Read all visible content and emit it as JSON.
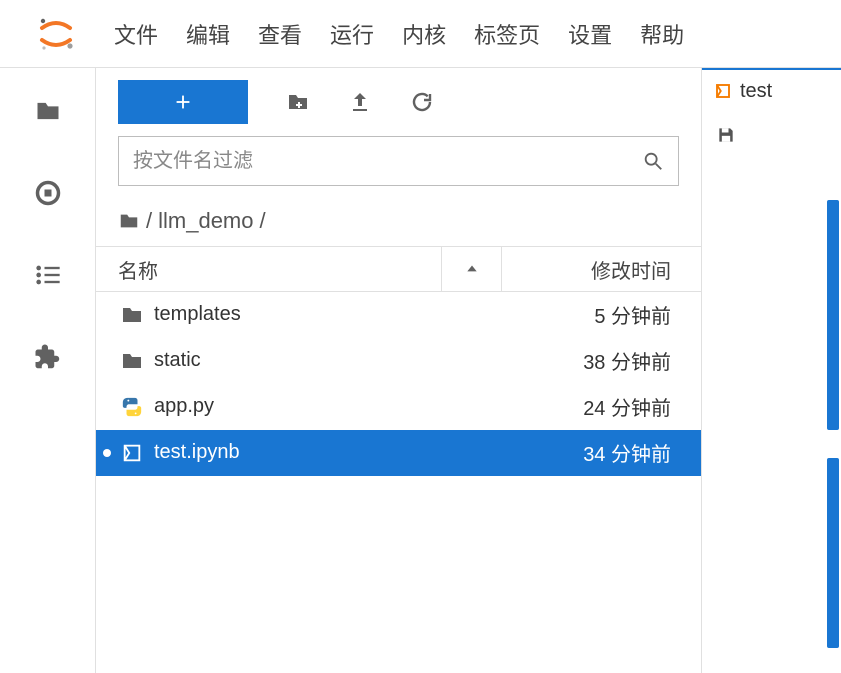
{
  "menubar": {
    "items": [
      "文件",
      "编辑",
      "查看",
      "运行",
      "内核",
      "标签页",
      "设置",
      "帮助"
    ]
  },
  "filebrowser": {
    "filter_placeholder": "按文件名过滤",
    "breadcrumb": {
      "root_sep": "/",
      "folder": "llm_demo",
      "trail_sep": "/"
    },
    "columns": {
      "name": "名称",
      "modified": "修改时间"
    },
    "items": [
      {
        "icon": "folder",
        "name": "templates",
        "modified": "5 分钟前",
        "selected": false
      },
      {
        "icon": "folder",
        "name": "static",
        "modified": "38 分钟前",
        "selected": false
      },
      {
        "icon": "python",
        "name": "app.py",
        "modified": "24 分钟前",
        "selected": false
      },
      {
        "icon": "notebook",
        "name": "test.ipynb",
        "modified": "34 分钟前",
        "selected": true
      }
    ]
  },
  "rail": {
    "items": [
      "folder",
      "running",
      "toc",
      "extensions"
    ]
  },
  "tabs": {
    "open": [
      {
        "icon": "notebook",
        "label": "test"
      }
    ]
  },
  "icons": {
    "plus": "+",
    "new_folder": "new-folder",
    "upload": "upload",
    "refresh": "refresh",
    "search": "search",
    "save": "save",
    "sort_asc": "▲"
  },
  "colors": {
    "accent": "#1976d2",
    "icon_gray": "#616161",
    "notebook_orange": "#f57c00"
  }
}
